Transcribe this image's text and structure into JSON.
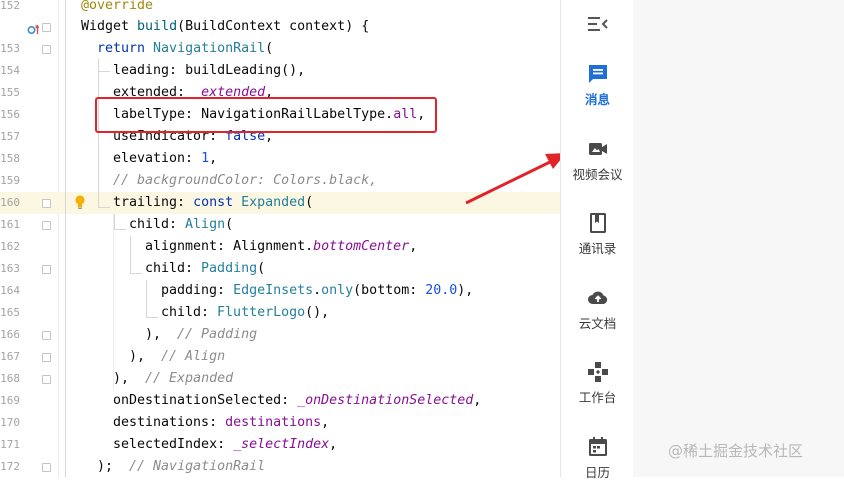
{
  "editor": {
    "lines": [
      {
        "num": "152",
        "segments": [
          {
            "t": "@override",
            "c": "anno"
          }
        ]
      },
      {
        "num": "",
        "segments": [
          {
            "t": "Widget ",
            "c": ""
          },
          {
            "t": "build",
            "c": "fn"
          },
          {
            "t": "(BuildContext context) {",
            "c": ""
          }
        ]
      },
      {
        "num": "153",
        "segments": [
          {
            "t": "return ",
            "c": "kw"
          },
          {
            "t": "NavigationRail",
            "c": "type"
          },
          {
            "t": "(",
            "c": ""
          }
        ]
      },
      {
        "num": "154",
        "segments": [
          {
            "t": "leading: ",
            "c": ""
          },
          {
            "t": "buildLeading",
            "c": ""
          },
          {
            "t": "(),",
            "c": ""
          }
        ]
      },
      {
        "num": "155",
        "segments": [
          {
            "t": "extended: ",
            "c": ""
          },
          {
            "t": "_extended",
            "c": "italic"
          },
          {
            "t": ",",
            "c": ""
          }
        ]
      },
      {
        "num": "156",
        "segments": [
          {
            "t": "labelType: ",
            "c": ""
          },
          {
            "t": "NavigationRailLabelType.",
            "c": ""
          },
          {
            "t": "all",
            "c": "prop"
          },
          {
            "t": ",",
            "c": ""
          }
        ]
      },
      {
        "num": "157",
        "segments": [
          {
            "t": "useIndicator: ",
            "c": ""
          },
          {
            "t": "false",
            "c": "kw"
          },
          {
            "t": ",",
            "c": ""
          }
        ]
      },
      {
        "num": "158",
        "segments": [
          {
            "t": "elevation: ",
            "c": ""
          },
          {
            "t": "1",
            "c": "num"
          },
          {
            "t": ",",
            "c": ""
          }
        ]
      },
      {
        "num": "159",
        "segments": [
          {
            "t": "// backgroundColor: Colors.black,",
            "c": "comment"
          }
        ]
      },
      {
        "num": "160",
        "segments": [
          {
            "t": "trailing: ",
            "c": ""
          },
          {
            "t": "const ",
            "c": "kw"
          },
          {
            "t": "Expanded",
            "c": "type"
          },
          {
            "t": "(",
            "c": ""
          }
        ]
      },
      {
        "num": "161",
        "segments": [
          {
            "t": "child: ",
            "c": ""
          },
          {
            "t": "Align",
            "c": "type"
          },
          {
            "t": "(",
            "c": ""
          }
        ]
      },
      {
        "num": "162",
        "segments": [
          {
            "t": "alignment: ",
            "c": ""
          },
          {
            "t": "Alignment.",
            "c": ""
          },
          {
            "t": "bottomCenter",
            "c": "italic"
          },
          {
            "t": ",",
            "c": ""
          }
        ]
      },
      {
        "num": "163",
        "segments": [
          {
            "t": "child: ",
            "c": ""
          },
          {
            "t": "Padding",
            "c": "type"
          },
          {
            "t": "(",
            "c": ""
          }
        ]
      },
      {
        "num": "164",
        "segments": [
          {
            "t": "padding: ",
            "c": ""
          },
          {
            "t": "EdgeInsets",
            "c": "type"
          },
          {
            "t": ".",
            "c": ""
          },
          {
            "t": "only",
            "c": "type"
          },
          {
            "t": "(bottom: ",
            "c": ""
          },
          {
            "t": "20.0",
            "c": "num"
          },
          {
            "t": "),",
            "c": ""
          }
        ]
      },
      {
        "num": "165",
        "segments": [
          {
            "t": "child: ",
            "c": ""
          },
          {
            "t": "FlutterLogo",
            "c": "type"
          },
          {
            "t": "(),",
            "c": ""
          }
        ]
      },
      {
        "num": "166",
        "segments": [
          {
            "t": "),  ",
            "c": ""
          },
          {
            "t": "// Padding",
            "c": "comment"
          }
        ]
      },
      {
        "num": "167",
        "segments": [
          {
            "t": "),  ",
            "c": ""
          },
          {
            "t": "// Align",
            "c": "comment"
          }
        ]
      },
      {
        "num": "168",
        "segments": [
          {
            "t": "),  ",
            "c": ""
          },
          {
            "t": "// Expanded",
            "c": "comment"
          }
        ]
      },
      {
        "num": "169",
        "segments": [
          {
            "t": "onDestinationSelected: ",
            "c": ""
          },
          {
            "t": "_onDestinationSelected",
            "c": "italic"
          },
          {
            "t": ",",
            "c": ""
          }
        ]
      },
      {
        "num": "170",
        "segments": [
          {
            "t": "destinations: ",
            "c": ""
          },
          {
            "t": "destinations",
            "c": "prop"
          },
          {
            "t": ",",
            "c": ""
          }
        ]
      },
      {
        "num": "171",
        "segments": [
          {
            "t": "selectedIndex: ",
            "c": ""
          },
          {
            "t": "_selectIndex",
            "c": "italic"
          },
          {
            "t": ",",
            "c": ""
          }
        ]
      },
      {
        "num": "172",
        "segments": [
          {
            "t": ");  ",
            "c": ""
          },
          {
            "t": "// NavigationRail",
            "c": "comment"
          }
        ]
      }
    ]
  },
  "rail": {
    "leading_icon": "menu-collapse-icon",
    "destinations": [
      {
        "label": "消息",
        "icon": "message-icon",
        "selected": true
      },
      {
        "label": "视频会议",
        "icon": "video-icon",
        "selected": false
      },
      {
        "label": "通讯录",
        "icon": "contacts-book-icon",
        "selected": false
      },
      {
        "label": "云文档",
        "icon": "cloud-upload-icon",
        "selected": false
      },
      {
        "label": "工作台",
        "icon": "gamepad-icon",
        "selected": false
      },
      {
        "label": "日历",
        "icon": "calendar-icon",
        "selected": false
      }
    ],
    "selected_color": "#1e6fd8"
  },
  "watermark": "@稀土掘金技术社区"
}
